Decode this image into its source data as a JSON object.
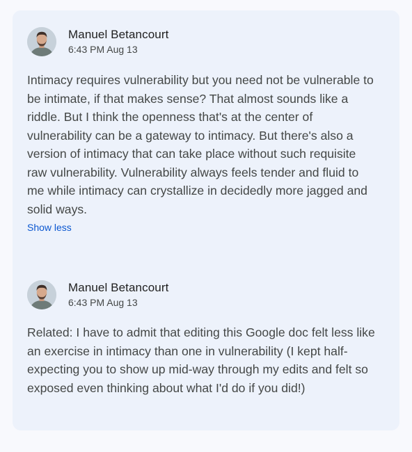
{
  "thread": {
    "comments": [
      {
        "author": "Manuel Betancourt",
        "timestamp": "6:43 PM Aug 13",
        "body": "Intimacy requires vulnerability but you need not be vulnerable to be intimate, if that makes sense? That almost sounds like a riddle. But I think the openness that's at the center of vulnerability can be a gateway to intimacy. But there's also a version of intimacy that can take place without such requisite raw vulnerability. Vulnerability always feels tender and fluid to me while intimacy can crystallize in decidedly more jagged and solid ways.",
        "toggle_label": "Show less",
        "avatar_icon": "avatar-person"
      },
      {
        "author": "Manuel Betancourt",
        "timestamp": "6:43 PM Aug 13",
        "body": "Related: I have to admit that editing this Google doc felt less like an exercise in intimacy than one in vulnerability (I kept half-expecting you to show up mid-way through my edits and felt so exposed even thinking about what I'd do if you did!)",
        "avatar_icon": "avatar-person"
      }
    ]
  },
  "colors": {
    "page_background": "#f8f9fd",
    "card_background": "#edf2fb",
    "link": "#0b57d0",
    "author_text": "#1f1f1f",
    "body_text": "#444746"
  }
}
